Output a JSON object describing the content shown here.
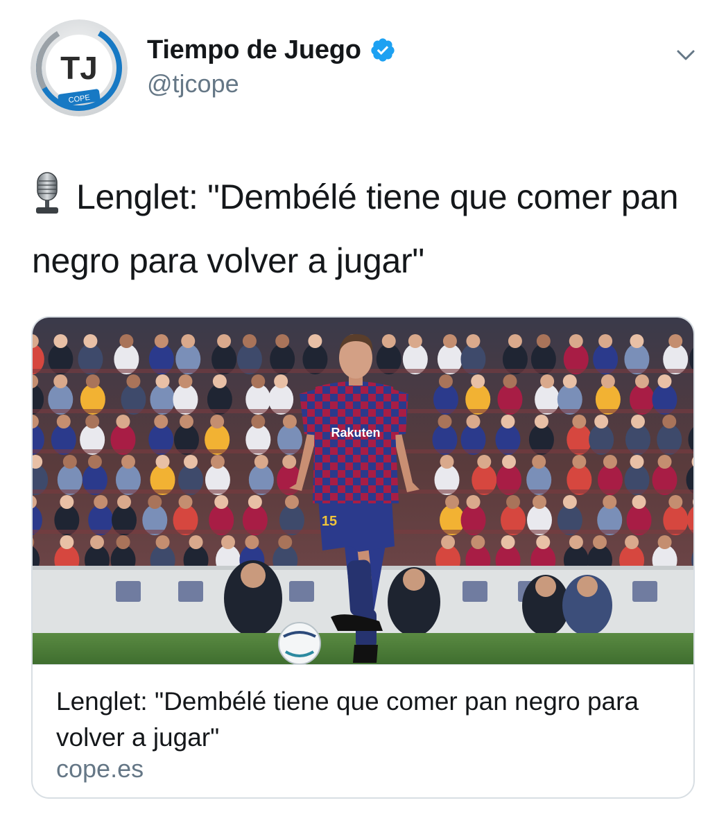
{
  "account": {
    "display_name": "Tiempo de Juego",
    "handle": "@tjcope",
    "avatar_letters": "TJ",
    "avatar_badge": "COPE",
    "verified": true
  },
  "tweet": {
    "icon": "microphone-icon",
    "text": "Lenglet: \"Dembélé tiene que comer pan negro para volver a jugar\""
  },
  "card": {
    "image_alt": "player-photo",
    "jersey_sponsor": "Rakuten",
    "jersey_number": "15",
    "title": "Lenglet: \"Dembélé tiene que comer pan negro para volver a jugar\"",
    "domain": "cope.es"
  },
  "colors": {
    "text_primary": "#14171a",
    "text_secondary": "#657786",
    "verified_blue": "#1da1f2",
    "card_border": "#d8dee3",
    "jersey_blue": "#2b3a8c",
    "jersey_red": "#a81d45",
    "pitch_green": "#4f7d3a"
  }
}
